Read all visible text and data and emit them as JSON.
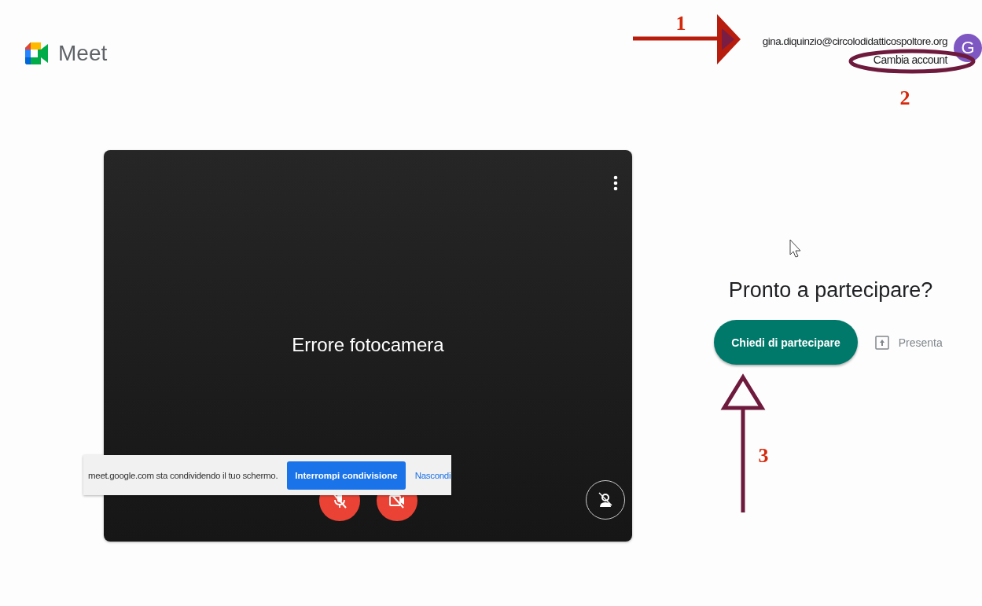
{
  "header": {
    "product_name": "Meet",
    "account": {
      "email": "gina.diquinzio@circolodidatticospoltore.org",
      "switch_label": "Cambia account",
      "avatar_initial": "G"
    }
  },
  "preview": {
    "message": "Errore fotocamera",
    "microphone_on": false,
    "camera_on": false
  },
  "join": {
    "title": "Pronto a partecipare?",
    "join_button": "Chiedi di partecipare",
    "present_button": "Presenta"
  },
  "share_bar": {
    "message": "meet.google.com sta condividendo il tuo schermo.",
    "stop_button": "Interrompi condivisione",
    "hide_link": "Nascondi"
  },
  "annotations": [
    {
      "label": "1",
      "kind": "arrow-right",
      "color": "#b81c0c"
    },
    {
      "label": "2",
      "kind": "ellipse",
      "color": "#6e1a3c"
    },
    {
      "label": "3",
      "kind": "arrow-up",
      "color": "#6e1a3c"
    }
  ]
}
